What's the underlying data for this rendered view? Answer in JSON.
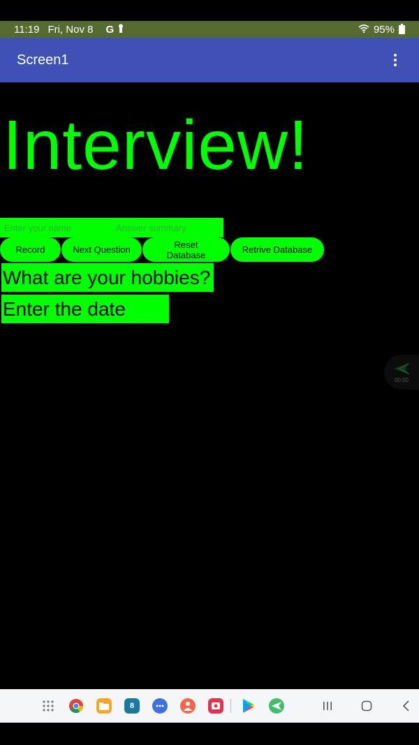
{
  "status_bar": {
    "time": "11:19",
    "date": "Fri, Nov 8",
    "notification_letter": "G",
    "battery": "95%"
  },
  "app_bar": {
    "title": "Screen1",
    "menu_icon": "overflow-vertical-icon"
  },
  "main": {
    "headline": "Interview!",
    "name_input": {
      "value": "",
      "placeholder": "Enter your name"
    },
    "summary_input": {
      "value": "",
      "placeholder": "Answer summary"
    },
    "buttons": {
      "record": "Record",
      "next_question": "Next Question",
      "reset_database": "Reset Database",
      "retrive_database": "Retrive Database"
    },
    "question_text": "What are your hobbies?",
    "date_text": "Enter the date"
  },
  "floating_widget": {
    "time": "00:00",
    "icon": "send-arrow-icon"
  },
  "nav_bar": {
    "apps": [
      "apps-grid-icon",
      "chrome-icon",
      "files-icon",
      "calendar-icon",
      "messages-icon",
      "contacts-icon",
      "screen-recorder-icon",
      "play-store-icon",
      "send-app-icon"
    ],
    "calendar_day": "8",
    "controls": [
      "recents-icon",
      "home-icon",
      "back-icon"
    ]
  },
  "colors": {
    "accent": "#00ff00",
    "app_bar": "#3f51b5",
    "status_bar": "#556b2f",
    "background": "#000000"
  }
}
